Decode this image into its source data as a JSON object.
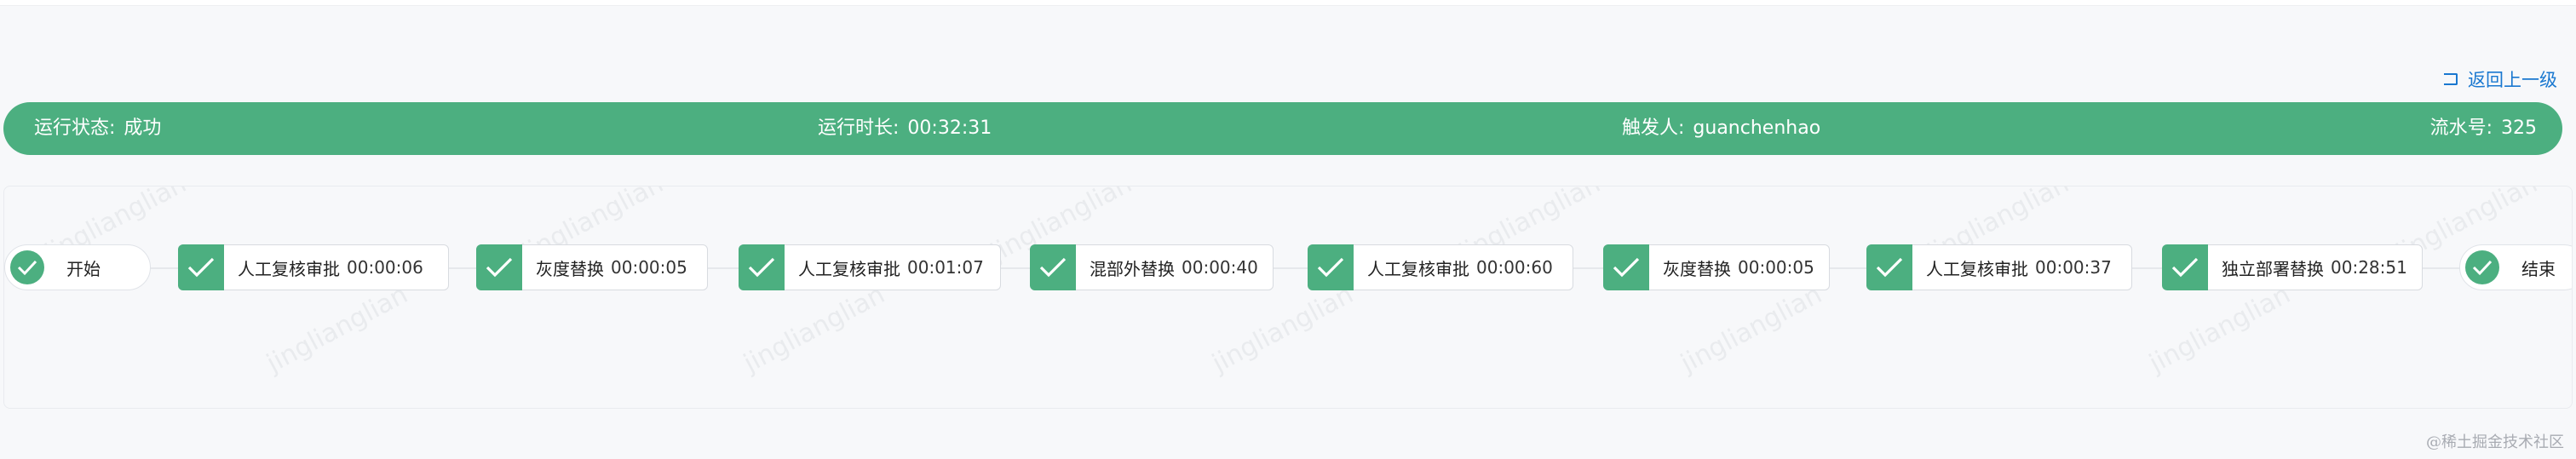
{
  "header": {
    "back_label": "返回上一级"
  },
  "status_bar": {
    "run_status_label": "运行状态:",
    "run_status_value": "成功",
    "duration_label": "运行时长:",
    "duration_value": "00:32:31",
    "trigger_label": "触发人:",
    "trigger_value": "guanchenhao",
    "serial_label": "流水号:",
    "serial_value": "325"
  },
  "pipeline": {
    "start_label": "开始",
    "end_label": "结束",
    "stages": [
      {
        "name": "人工复核审批",
        "time": "00:00:06"
      },
      {
        "name": "灰度替换",
        "time": "00:00:05"
      },
      {
        "name": "人工复核审批",
        "time": "00:01:07"
      },
      {
        "name": "混部外替换",
        "time": "00:00:40"
      },
      {
        "name": "人工复核审批",
        "time": "00:00:60"
      },
      {
        "name": "灰度替换",
        "time": "00:00:05"
      },
      {
        "name": "人工复核审批",
        "time": "00:00:37"
      },
      {
        "name": "独立部署替换",
        "time": "00:28:51"
      }
    ]
  },
  "watermark_text": "jinglianglian",
  "footer_mark": "@稀土掘金技术社区",
  "colors": {
    "success": "#4caf80",
    "link": "#1a78d0",
    "background": "#f7f8fa"
  },
  "icons": {
    "back": "return-arrow-icon",
    "stage_status": "check-icon"
  }
}
